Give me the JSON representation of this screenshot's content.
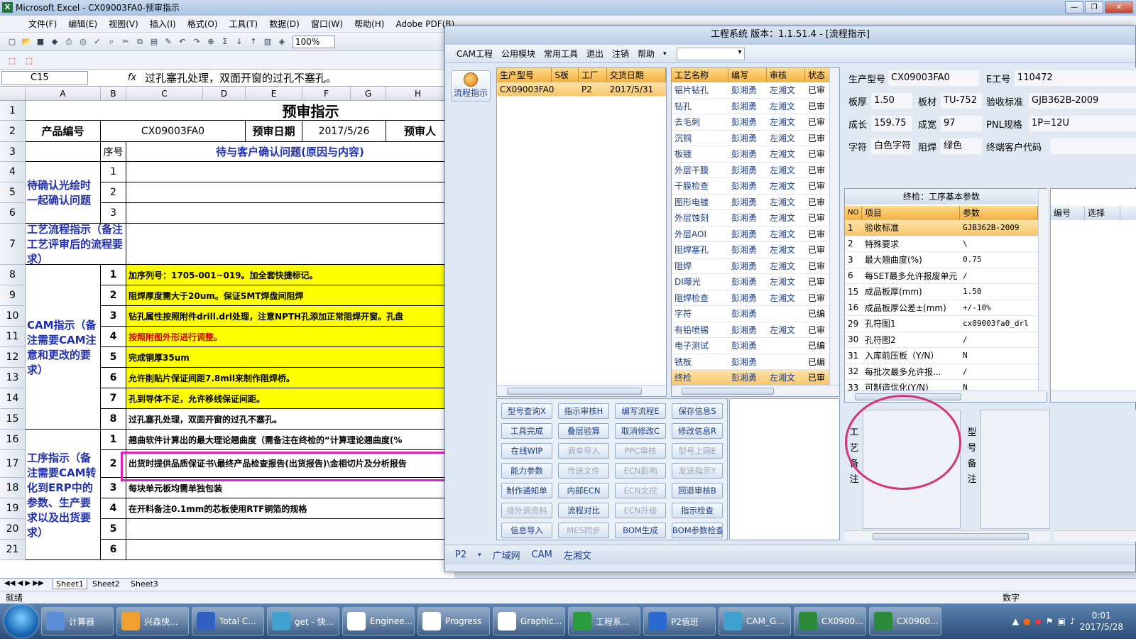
{
  "excel": {
    "title": "Microsoft Excel - CX09003FA0-预审指示",
    "menu": [
      "文件(F)",
      "编辑(E)",
      "视图(V)",
      "插入(I)",
      "格式(O)",
      "工具(T)",
      "数据(D)",
      "窗口(W)",
      "帮助(H)",
      "Adobe PDF(B)"
    ],
    "zoom": "100%",
    "namebox": "C15",
    "fx": "fx",
    "formula": "过孔塞孔处理，双面开窗的过孔不塞孔。",
    "columns": [
      "A",
      "B",
      "C",
      "D",
      "E",
      "F",
      "G",
      "H"
    ],
    "rows": [
      "1",
      "2",
      "3",
      "4",
      "5",
      "6",
      "7",
      "8",
      "9",
      "10",
      "11",
      "12",
      "13",
      "14",
      "15",
      "16",
      "17",
      "18",
      "19",
      "20",
      "21"
    ],
    "sheet_title": "预审指示",
    "product_label": "产品编号",
    "product_value": "CX09003FA0",
    "date_label": "预审日期",
    "date_value": "2017/5/26",
    "reviewer_label": "预审人",
    "seq_label": "序号",
    "confirm_header": "待与客户确认问题(原因与内容)",
    "group1": "待确认光绘时一起确认问题",
    "group2": "工艺流程指示（备注工艺评审后的流程要求）",
    "group3": "CAM指示（备注需要CAM注意和更改的要求）",
    "group4": "工序指示（备注需要CAM转化到ERP中的参数、生产要求以及出货要求）",
    "seq1": [
      "1",
      "2",
      "3"
    ],
    "cam_items": [
      {
        "n": "1",
        "t": "加序列号：1705-001~019。加全套快捷标记。"
      },
      {
        "n": "2",
        "t": "阻焊厚度需大于20um。保证SMT焊盘间阻焊"
      },
      {
        "n": "3",
        "t": "钻孔属性按照附件drill.drl处理，注意NPTH孔添加正常阻焊开窗。孔盘"
      },
      {
        "n": "4",
        "t": "按照附图外形进行调整。"
      },
      {
        "n": "5",
        "t": "完成铜厚35um"
      },
      {
        "n": "6",
        "t": "允许削贴片保证间距7.8mil来制作阻焊桥。"
      },
      {
        "n": "7",
        "t": "孔到导体不足，允许移线保证间距。"
      },
      {
        "n": "8",
        "t": "过孔塞孔处理，双面开窗的过孔不塞孔。"
      }
    ],
    "proc_items": [
      {
        "n": "1",
        "t": "翘曲软件计算出的最大理论翘曲度（需备注在终检的“计算理论翘曲度(%"
      },
      {
        "n": "2",
        "t": "出货时提供品质保证书\\最终产品检查报告(出货报告)\\金相切片及分析报告"
      },
      {
        "n": "3",
        "t": "每块单元板均需单独包装"
      },
      {
        "n": "4",
        "t": "在开料备注0.1mm的芯板使用RTF铜箔的规格"
      },
      {
        "n": "5",
        "t": ""
      },
      {
        "n": "6",
        "t": ""
      }
    ],
    "sheets": [
      "Sheet1",
      "Sheet2",
      "Sheet3"
    ],
    "status": "就绪",
    "status_right": "数字"
  },
  "app": {
    "title": "工程系统  版本：1.1.51.4 - [流程指示]",
    "menu": [
      "CAM工程",
      "公用模块",
      "常用工具",
      "退出",
      "注销",
      "帮助"
    ],
    "flow_btn": "流程指示",
    "orders_header": [
      "生产型号",
      "S板",
      "工厂",
      "交货日期"
    ],
    "orders": [
      {
        "model": "CX09003FA0",
        "s": "",
        "factory": "P2",
        "date": "2017/5/31"
      }
    ],
    "proc_header": [
      "工艺名称",
      "编写",
      "审核",
      "状态"
    ],
    "procs": [
      [
        "铝片钻孔",
        "彭湘勇",
        "左湘文",
        "已审"
      ],
      [
        "钻孔",
        "彭湘勇",
        "左湘文",
        "已审"
      ],
      [
        "去毛刺",
        "彭湘勇",
        "左湘文",
        "已审"
      ],
      [
        "沉铜",
        "彭湘勇",
        "左湘文",
        "已审"
      ],
      [
        "板镀",
        "彭湘勇",
        "左湘文",
        "已审"
      ],
      [
        "外层干膜",
        "彭湘勇",
        "左湘文",
        "已审"
      ],
      [
        "干膜检查",
        "彭湘勇",
        "左湘文",
        "已审"
      ],
      [
        "图形电镀",
        "彭湘勇",
        "左湘文",
        "已审"
      ],
      [
        "外层蚀刻",
        "彭湘勇",
        "左湘文",
        "已审"
      ],
      [
        "外层AOI",
        "彭湘勇",
        "左湘文",
        "已审"
      ],
      [
        "阻焊塞孔",
        "彭湘勇",
        "左湘文",
        "已审"
      ],
      [
        "阻焊",
        "彭湘勇",
        "左湘文",
        "已审"
      ],
      [
        "DI曝光",
        "彭湘勇",
        "左湘文",
        "已审"
      ],
      [
        "阻焊检查",
        "彭湘勇",
        "左湘文",
        "已审"
      ],
      [
        "字符",
        "彭湘勇",
        "",
        "已编"
      ],
      [
        "有铅喷锡",
        "彭湘勇",
        "左湘文",
        "已审"
      ],
      [
        "电子测试",
        "彭湘勇",
        "",
        "已编"
      ],
      [
        "铣板",
        "彭湘勇",
        "",
        "已编"
      ],
      [
        "终检",
        "彭湘勇",
        "左湘文",
        "已审"
      ]
    ],
    "buttons": [
      [
        "型号查询X",
        "指示审核H",
        "编写流程E",
        "保存信息S"
      ],
      [
        "工具完成",
        "叠层验算",
        "取消修改C",
        "修改信息R"
      ],
      [
        "在线WIP",
        "调单导入",
        "PPC审核",
        "型号上网E"
      ],
      [
        "能力参数",
        "传送文件",
        "ECN影响",
        "发送指示Y"
      ],
      [
        "制作通知单",
        "内部ECN",
        "ECN文控",
        "回退审核B"
      ],
      [
        "接外调资料",
        "流程对比",
        "ECN升级",
        "指示检查"
      ],
      [
        "信息导入",
        "MES同步",
        "BOM生成",
        "BOM参数检查"
      ]
    ],
    "info": {
      "model_l": "生产型号",
      "model_v": "CX09003FA0",
      "emp_l": "E工号",
      "emp_v": "110472",
      "thick_l": "板厚",
      "thick_v": "1.50",
      "mat_l": "板材",
      "mat_v": "TU-752",
      "std_l": "验收标准",
      "std_v": "GJB362B-2009",
      "len_l": "成长",
      "len_v": "159.75",
      "wid_l": "成宽",
      "wid_v": "97",
      "pnl_l": "PNL规格",
      "pnl_v": "1P=12U",
      "char_l": "字符",
      "char_v": "白色字符",
      "mask_l": "阻焊",
      "mask_v": "绿色",
      "cust_l": "终端客户代码"
    },
    "params_title": "终检：工序基本参数",
    "params_header": [
      "NO",
      "项目",
      "参数"
    ],
    "params": [
      [
        "1",
        "验收标准",
        "GJB362B-2009"
      ],
      [
        "2",
        "特殊要求",
        "\\"
      ],
      [
        "3",
        "最大翘曲度(%)",
        "0.75"
      ],
      [
        "6",
        "每SET最多允许报废单元",
        "/"
      ],
      [
        "15",
        "成品板厚(mm)",
        "1.50"
      ],
      [
        "16",
        "成品板厚公差±(mm)",
        "+/-10%"
      ],
      [
        "29",
        "孔符图1",
        "cx09003fa0_drl"
      ],
      [
        "30",
        "孔符图2",
        "/"
      ],
      [
        "31",
        "入库前压板（Y/N）",
        "N"
      ],
      [
        "32",
        "每批次最多允许报...",
        "/"
      ],
      [
        "33",
        "可制造优化(Y/N)",
        "N"
      ]
    ],
    "right_header": [
      "编号",
      "选择"
    ],
    "note_label": "工艺备注",
    "model_note_label": "型号备注",
    "bottom": [
      "P2",
      "广域网",
      "CAM",
      "左湘文"
    ]
  },
  "taskbar": {
    "items": [
      "计算器",
      "兴森快...",
      "Total C...",
      "get - 快...",
      "Enginee...",
      "Progress",
      "Graphic...",
      "工程系...",
      "P2值班",
      "CAM_G...",
      "CX0900...",
      "CX0900..."
    ],
    "time": "0:01",
    "date": "2017/5/28"
  },
  "colors": {
    "highlight_box": "#e020c0",
    "circle": "#d6337a",
    "yellow": "#ffff00",
    "accent": "#1f2fb4"
  }
}
